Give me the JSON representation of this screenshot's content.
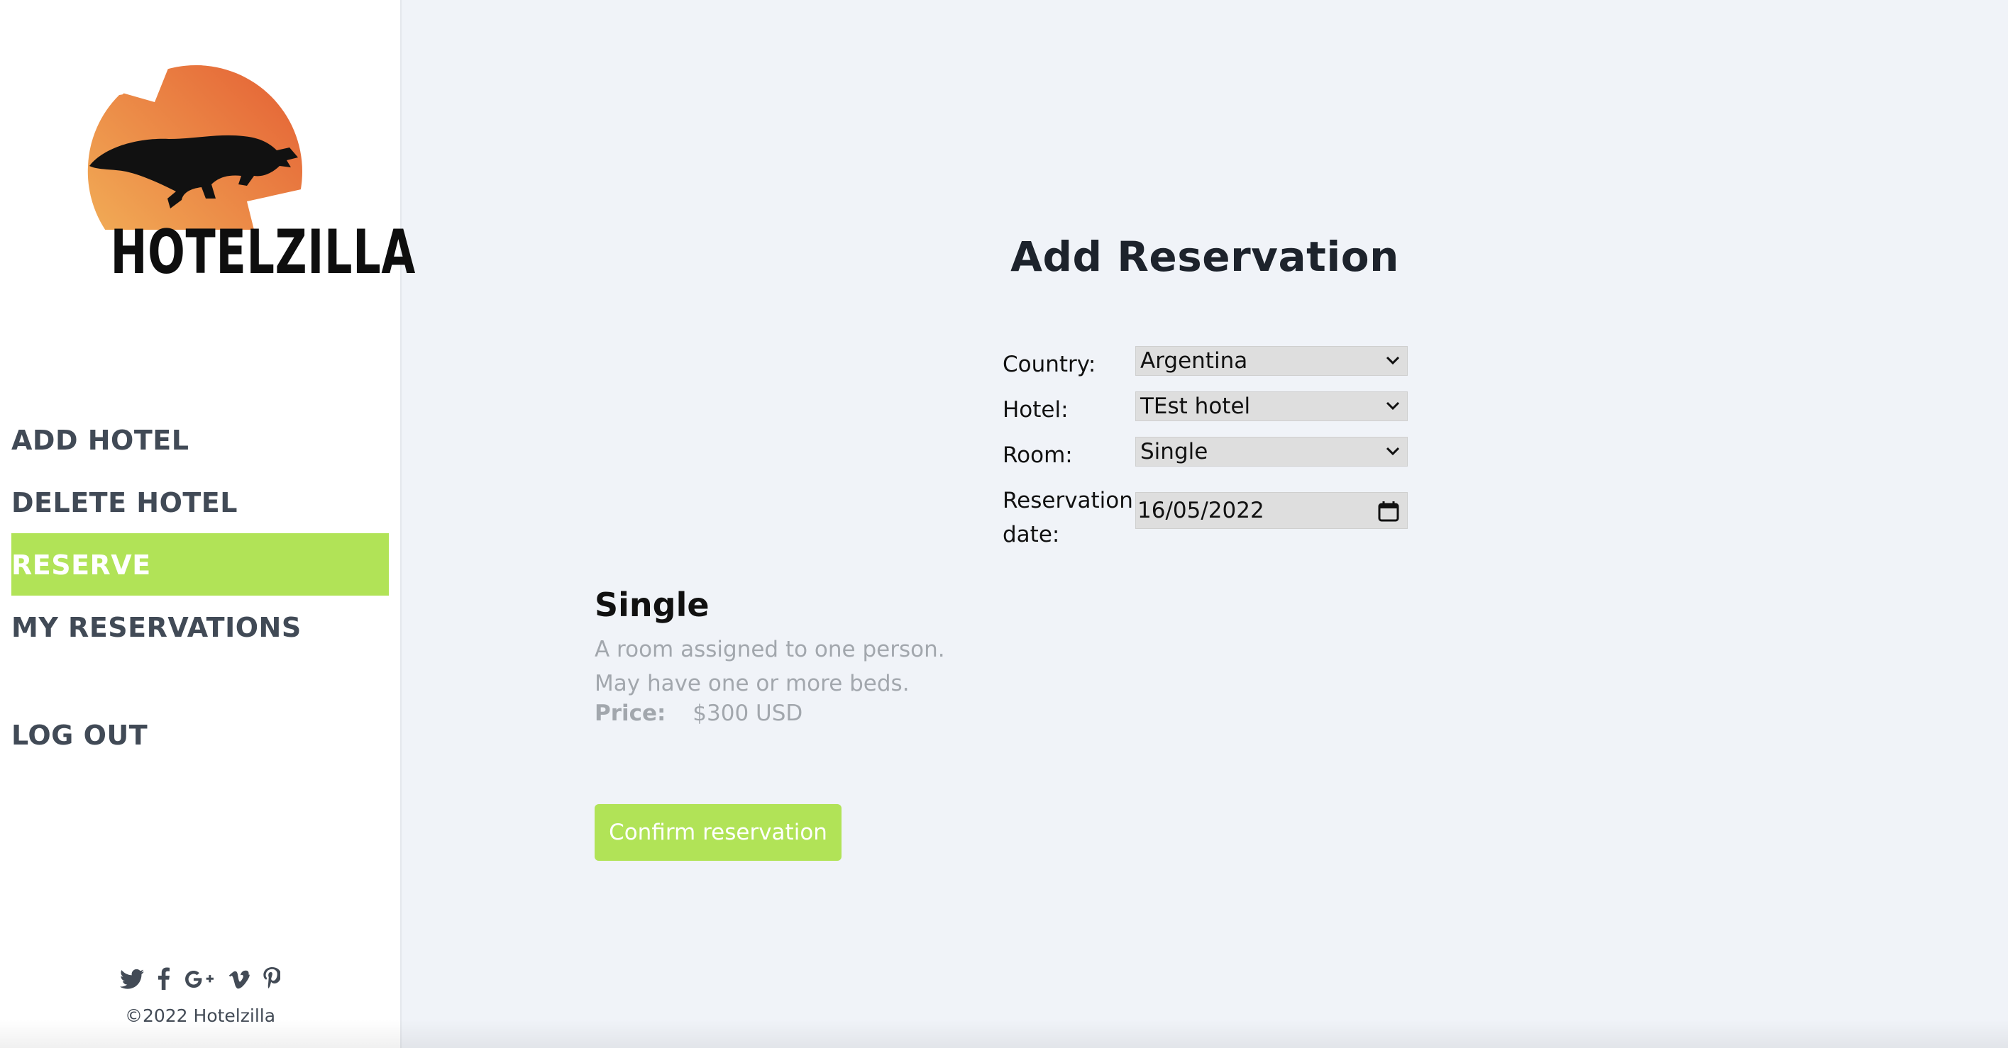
{
  "brand": {
    "name": "HOTELZILLA"
  },
  "sidebar": {
    "items": [
      {
        "label": "ADD HOTEL"
      },
      {
        "label": "DELETE HOTEL"
      },
      {
        "label": "RESERVE"
      },
      {
        "label": "MY RESERVATIONS"
      },
      {
        "label": "LOG OUT"
      }
    ],
    "active_item": "RESERVE",
    "active_color": "#b1e357",
    "social_icons": [
      "twitter-icon",
      "facebook-icon",
      "google-plus-icon",
      "vimeo-icon",
      "pinterest-icon"
    ],
    "copyright": "©2022 Hotelzilla"
  },
  "main": {
    "title": "Add Reservation",
    "form": {
      "country_label": "Country:",
      "country_value": "Argentina",
      "hotel_label": "Hotel:",
      "hotel_value": "TEst hotel",
      "room_label": "Room:",
      "room_value": "Single",
      "date_label": "Reservation date:",
      "date_value": "16/05/2022"
    },
    "room": {
      "name": "Single",
      "description": "A room assigned to one person. May have one or more beds.",
      "price_label": "Price:",
      "price_value": "$300 USD"
    },
    "confirm_label": "Confirm reservation"
  }
}
